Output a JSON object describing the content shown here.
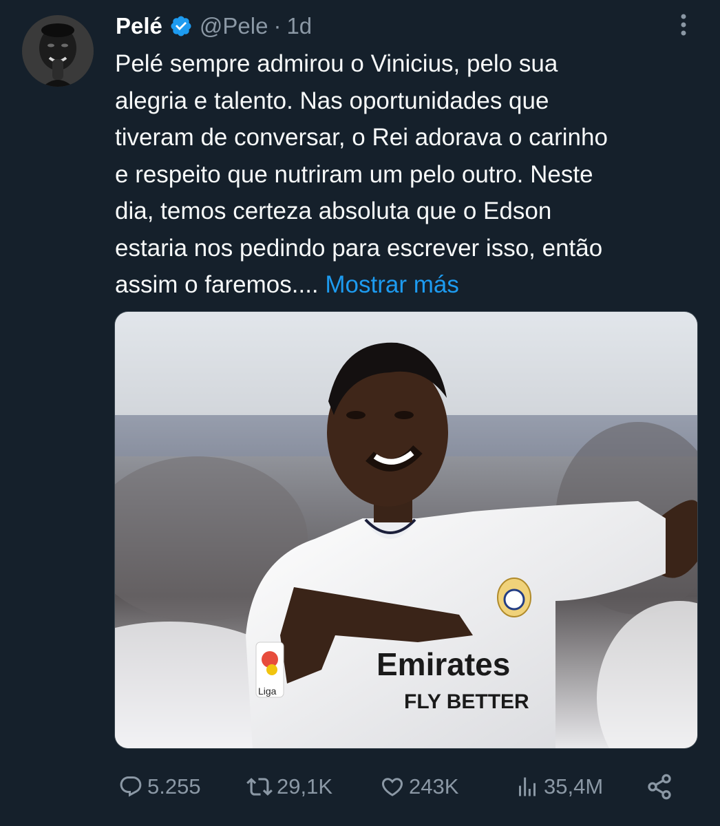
{
  "tweet": {
    "author": {
      "name": "Pelé",
      "handle": "@Pele",
      "separator": "·",
      "time": "1d",
      "verified": true,
      "avatar_icon": "profile-photo"
    },
    "text_lines": [
      "Pelé sempre admirou o Vinicius, pelo sua",
      "alegria e talento. Nas oportunidades que",
      "tiveram de conversar, o Rei adorava o carinho",
      "e respeito que nutriram um pelo outro. Neste",
      "dia, temos certeza absoluta que o Edson",
      "estaria nos pedindo para escrever isso, então",
      "assim o faremos...."
    ],
    "show_more_label": "Mostrar más",
    "media": {
      "kind": "photo",
      "jersey_text_1": "Emirates",
      "jersey_text_2": "FLY BETTER",
      "badge_text": "Liga"
    },
    "actions": {
      "replies": "5.255",
      "retweets": "29,1K",
      "likes": "243K",
      "views": "35,4M"
    }
  },
  "colors": {
    "background": "#15202b",
    "text": "#f7f9f9",
    "secondary": "#8b98a5",
    "accent": "#1d9bf0",
    "verified_badge": "#1d9bf0"
  }
}
